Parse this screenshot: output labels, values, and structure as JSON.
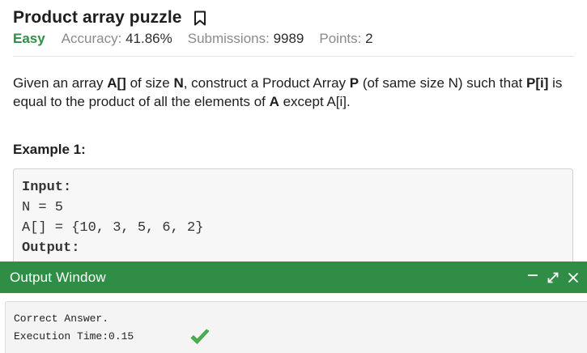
{
  "problem": {
    "title": "Product array puzzle",
    "difficulty": "Easy",
    "meta": [
      {
        "label": "Accuracy: ",
        "value": "41.86%"
      },
      {
        "label": "Submissions: ",
        "value": "9989"
      },
      {
        "label": "Points: ",
        "value": "2"
      }
    ],
    "statement": {
      "p1": "Given an array ",
      "b1": "A[]",
      "p2": " of size ",
      "b2": "N",
      "p3": ", construct a Product Array ",
      "b3": "P",
      "p4": " (of same size N) such that ",
      "b4": "P[i]",
      "p5": " is equal to the product of all the elements of ",
      "b5": "A",
      "p6": " except A[i]."
    },
    "example_heading": "Example 1:",
    "example": {
      "input_label": "Input:",
      "line_n": "N = 5",
      "line_a": "A[] = {10, 3, 5, 6, 2}",
      "output_label": "Output:"
    }
  },
  "output_window": {
    "title": "Output Window",
    "result_text": "Correct Answer.",
    "execution_time": "Execution Time:0.15",
    "accent_color": "#2f8d46",
    "check_color": "#4caf50"
  },
  "icons": {
    "bookmark": "bookmark-icon",
    "minimize": "minimize-icon",
    "expand": "expand-icon",
    "close": "close-icon",
    "check": "check-icon"
  }
}
